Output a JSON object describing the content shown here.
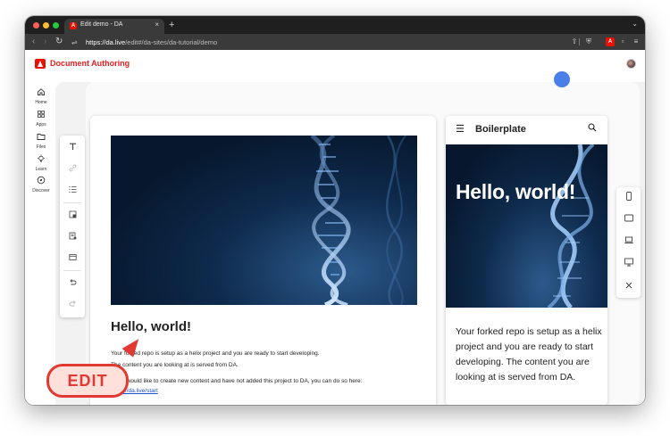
{
  "browser": {
    "tab_title": "Edit demo - DA",
    "tab_favicon": "A",
    "new_tab": "+",
    "tab_close": "×",
    "url_domain": "https://da.live",
    "url_path": "/edit#/da-sites/da-tutorial/demo"
  },
  "app": {
    "title": "Document Authoring",
    "nav": [
      {
        "label": "Home",
        "icon": "home-icon"
      },
      {
        "label": "Apps",
        "icon": "apps-icon"
      },
      {
        "label": "Files",
        "icon": "folder-icon"
      },
      {
        "label": "Learn",
        "icon": "lightbulb-icon"
      },
      {
        "label": "Discover",
        "icon": "compass-icon"
      }
    ]
  },
  "editor": {
    "heading": "Hello, world!",
    "line1": "Your forked repo is setup as a helix project and you are ready to start developing.",
    "line2": "The content you are looking at is served from DA.",
    "line3": "If you would like to create new content and have not added this project to DA, you can do so here:",
    "link": "https://da.live/start",
    "toolbar_icons": [
      "text-icon",
      "link-icon",
      "list-icon",
      "block-icon",
      "library-icon",
      "section-icon",
      "undo-icon",
      "redo-icon"
    ]
  },
  "badge": {
    "label": "EDIT"
  },
  "preview": {
    "brand": "Boilerplate",
    "hero_title": "Hello, world!",
    "body": "Your forked repo is setup as a helix project and you are ready to start developing. The content you are looking at is served from DA.",
    "devices": [
      "mobile-icon",
      "tablet-icon",
      "laptop-icon",
      "desktop-icon",
      "close-icon"
    ]
  },
  "colors": {
    "brand_red": "#e51e1e",
    "badge_red": "#e03a32",
    "link_blue": "#1a4fd6"
  }
}
